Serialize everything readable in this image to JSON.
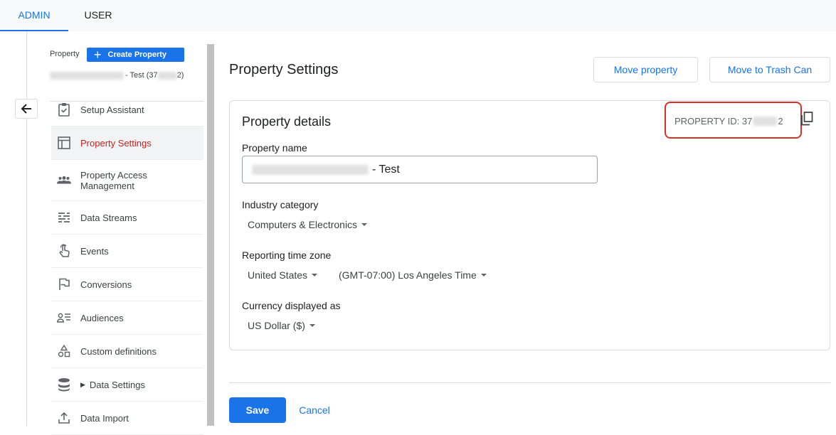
{
  "tabs": {
    "admin": "ADMIN",
    "user": "USER"
  },
  "sidebar": {
    "property_label": "Property",
    "create_property": "Create Property",
    "property_name_suffix": "- Test (37",
    "property_name_end": "2)",
    "items": [
      {
        "label": "Setup Assistant",
        "icon": "checklist-icon"
      },
      {
        "label": "Property Settings",
        "icon": "layout-icon",
        "active": true
      },
      {
        "label": "Property Access Management",
        "icon": "people-icon"
      },
      {
        "label": "Data Streams",
        "icon": "streams-icon"
      },
      {
        "label": "Events",
        "icon": "touch-icon"
      },
      {
        "label": "Conversions",
        "icon": "flag-icon"
      },
      {
        "label": "Audiences",
        "icon": "audience-icon"
      },
      {
        "label": "Custom definitions",
        "icon": "shapes-icon"
      },
      {
        "label": "Data Settings",
        "icon": "database-icon",
        "expandable": true
      },
      {
        "label": "Data Import",
        "icon": "upload-icon"
      }
    ]
  },
  "header": {
    "title": "Property Settings",
    "move_property": "Move property",
    "move_to_trash": "Move to Trash Can"
  },
  "card": {
    "title": "Property details",
    "property_id_prefix": "PROPERTY ID: 37",
    "property_id_suffix": "2",
    "property_name_label": "Property name",
    "property_name_suffix": "- Test",
    "industry_label": "Industry category",
    "industry_value": "Computers & Electronics",
    "timezone_label": "Reporting time zone",
    "timezone_country": "United States",
    "timezone_value": "(GMT-07:00) Los Angeles Time",
    "currency_label": "Currency displayed as",
    "currency_value": "US Dollar ($)"
  },
  "footer": {
    "save": "Save",
    "cancel": "Cancel"
  },
  "colors": {
    "accent": "#1a73e8",
    "active_nav_text": "#c5221f",
    "highlight_border": "#d93025"
  }
}
